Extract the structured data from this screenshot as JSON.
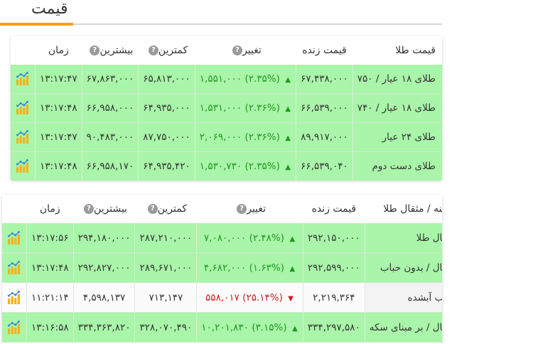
{
  "page": {
    "title": "قیمت"
  },
  "gold_table": {
    "headers": {
      "name": "قیمت طلا",
      "live": "قیمت زنده",
      "change": "تغییر",
      "low": "کمترین",
      "high": "بیشترین",
      "time": "زمان"
    },
    "rows": [
      {
        "name": "طلای ۱۸ عیار / ۷۵۰",
        "price": "۶۷,۴۳۸,۰۰۰",
        "change_value": "۱,۵۵۱,۰۰۰",
        "change_pct": "(۲.۳۵%)",
        "low": "۶۵,۸۱۳,۰۰۰",
        "high": "۶۷,۸۶۳,۰۰۰",
        "time": "۱۳:۱۷:۴۷",
        "direction": "up",
        "highlight": "green"
      },
      {
        "name": "طلای ۱۸ عیار / ۷۴۰",
        "price": "۶۶,۵۳۹,۰۰۰",
        "change_value": "۱,۵۳۱,۰۰۰",
        "change_pct": "(۲.۳۶%)",
        "low": "۶۴,۹۳۵,۰۰۰",
        "high": "۶۶,۹۵۸,۰۰۰",
        "time": "۱۳:۱۷:۴۸",
        "direction": "up",
        "highlight": "green"
      },
      {
        "name": "طلای ۲۴ عیار",
        "price": "۸۹,۹۱۷,۰۰۰",
        "change_value": "۲,۰۶۹,۰۰۰",
        "change_pct": "(۲.۳۶%)",
        "low": "۸۷,۷۵۰,۰۰۰",
        "high": "۹۰,۴۸۳,۰۰۰",
        "time": "۱۳:۱۷:۴۷",
        "direction": "up",
        "highlight": "green"
      },
      {
        "name": "طلای دست دوم",
        "price": "۶۶,۵۳۹,۰۴۰",
        "change_value": "۱,۵۳۰,۷۳۰",
        "change_pct": "(۲.۳۵%)",
        "low": "۶۴,۹۳۵,۴۲۰",
        "high": "۶۶,۹۵۸,۱۷۰",
        "time": "۱۳:۱۷:۴۸",
        "direction": "up",
        "highlight": "green"
      }
    ]
  },
  "mesghal_table": {
    "headers": {
      "name": "مظنه / مثقال طلا",
      "live": "قیمت زنده",
      "change": "تغییر",
      "low": "کمترین",
      "high": "بیشترین",
      "time": "زمان"
    },
    "rows": [
      {
        "name": "مثقال طلا",
        "price": "۲۹۲,۱۵۰,۰۰۰",
        "change_value": "۷,۰۸۰,۰۰۰",
        "change_pct": "(۲.۴۸%)",
        "low": "۲۸۷,۲۱۰,۰۰۰",
        "high": "۲۹۴,۱۸۰,۰۰۰",
        "time": "۱۳:۱۷:۵۶",
        "direction": "up",
        "highlight": "green"
      },
      {
        "name": "مثقال / بدون حباب",
        "price": "۲۹۲,۵۹۹,۰۰۰",
        "change_value": "۴,۶۸۲,۰۰۰",
        "change_pct": "(۱.۶۳%)",
        "low": "۲۸۹,۶۷۱,۰۰۰",
        "high": "۲۹۲,۸۲۷,۰۰۰",
        "time": "۱۳:۱۷:۴۸",
        "direction": "up",
        "highlight": "green"
      },
      {
        "name": "حباب آبشده",
        "price": "۲,۲۱۹,۳۶۴",
        "change_value": "۵۵۸,۰۱۷",
        "change_pct": "(۲۵.۱۴%)",
        "low": "۷۱۳,۱۴۷",
        "high": "۴,۵۹۸,۱۳۷",
        "time": "۱۱:۲۱:۱۴",
        "direction": "down",
        "highlight": "none"
      },
      {
        "name": "مثقال / بر مبنای سکه",
        "price": "۳۳۴,۲۹۷,۵۸۰",
        "change_value": "۱۰,۲۰۱,۸۳۰",
        "change_pct": "(۳.۱۵%)",
        "low": "۳۲۸,۰۷۰,۴۹۰",
        "high": "۳۳۴,۳۶۳,۸۲۰",
        "time": "۱۳:۱۶:۵۸",
        "direction": "up",
        "highlight": "green"
      }
    ]
  },
  "icons": {
    "help": "help-circle-icon",
    "chart": "bar-chart-icon",
    "up": "caret-up-icon",
    "down": "caret-down-icon"
  },
  "colors": {
    "row_green": "#a9f5a9",
    "up": "#1e9a1e",
    "down": "#c41f1f",
    "accent": "#f5a31a"
  }
}
